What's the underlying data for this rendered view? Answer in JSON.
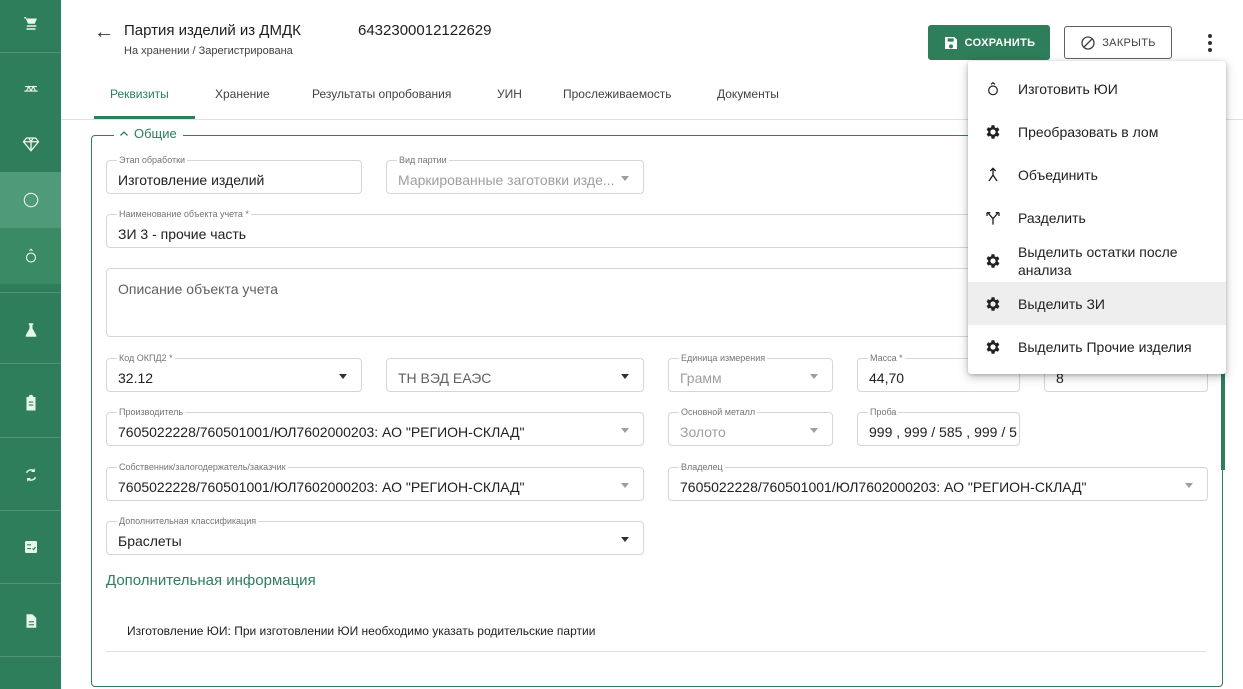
{
  "header": {
    "title": "Партия изделий из ДМДК",
    "status": "На хранении / Зарегистрирована",
    "doc_number": "6432300012122629",
    "save_label": "СОХРАНИТЬ",
    "close_label": "ЗАКРЫТЬ"
  },
  "tabs": [
    {
      "label": "Реквизиты"
    },
    {
      "label": "Хранение"
    },
    {
      "label": "Результаты опробования"
    },
    {
      "label": "УИН"
    },
    {
      "label": "Прослеживаемость"
    },
    {
      "label": "Документы"
    }
  ],
  "section": {
    "title": "Общие"
  },
  "fields": {
    "stage": {
      "label": "Этап обработки",
      "value": "Изготовление изделий"
    },
    "batch_type": {
      "label": "Вид партии",
      "value": "Маркированные заготовки изде..."
    },
    "name": {
      "label": "Наименование объекта учета *",
      "value": "ЗИ 3 - прочие часть"
    },
    "description": {
      "placeholder": "Описание объекта учета"
    },
    "okpd2": {
      "label": "Код ОКПД2 *",
      "value": "32.12"
    },
    "tnved": {
      "value": "ТН ВЭД ЕАЭС"
    },
    "unit": {
      "label": "Единица измерения",
      "value": "Грамм"
    },
    "mass": {
      "label": "Масса *",
      "value": "44,70"
    },
    "quantity": {
      "value": "8"
    },
    "manufacturer": {
      "label": "Производитель",
      "value": "7605022228/760501001/ЮЛ7602000203: АО \"РЕГИОН-СКЛАД\""
    },
    "metal": {
      "label": "Основной металл",
      "value": "Золото"
    },
    "probe": {
      "label": "Проба",
      "value": "999 , 999 / 585 , 999 / 5"
    },
    "owner": {
      "label": "Собственник/залогодержатель/заказчик",
      "value": "7605022228/760501001/ЮЛ7602000203: АО \"РЕГИОН-СКЛАД\""
    },
    "holder": {
      "label": "Владелец",
      "value": "7605022228/760501001/ЮЛ7602000203: АО \"РЕГИОН-СКЛАД\""
    },
    "classification": {
      "label": "Дополнительная классификация",
      "value": "Браслеты"
    }
  },
  "additional_info": {
    "title": "Дополнительная информация",
    "note": "Изготовление ЮИ: При изготовлении ЮИ необходимо указать родительские партии"
  },
  "menu": {
    "items": [
      {
        "label": "Изготовить ЮИ",
        "icon": "ring-icon"
      },
      {
        "label": "Преобразовать в лом",
        "icon": "gear-icon"
      },
      {
        "label": "Объединить",
        "icon": "merge-icon"
      },
      {
        "label": "Разделить",
        "icon": "split-icon"
      },
      {
        "label": "Выделить остатки после анализа",
        "icon": "gear-icon"
      },
      {
        "label": "Выделить ЗИ",
        "icon": "gear-icon"
      },
      {
        "label": "Выделить Прочие изделия",
        "icon": "gear-icon"
      }
    ]
  },
  "colors": {
    "accent": "#2e7d5b",
    "sidebar": "#2e7d5b"
  }
}
